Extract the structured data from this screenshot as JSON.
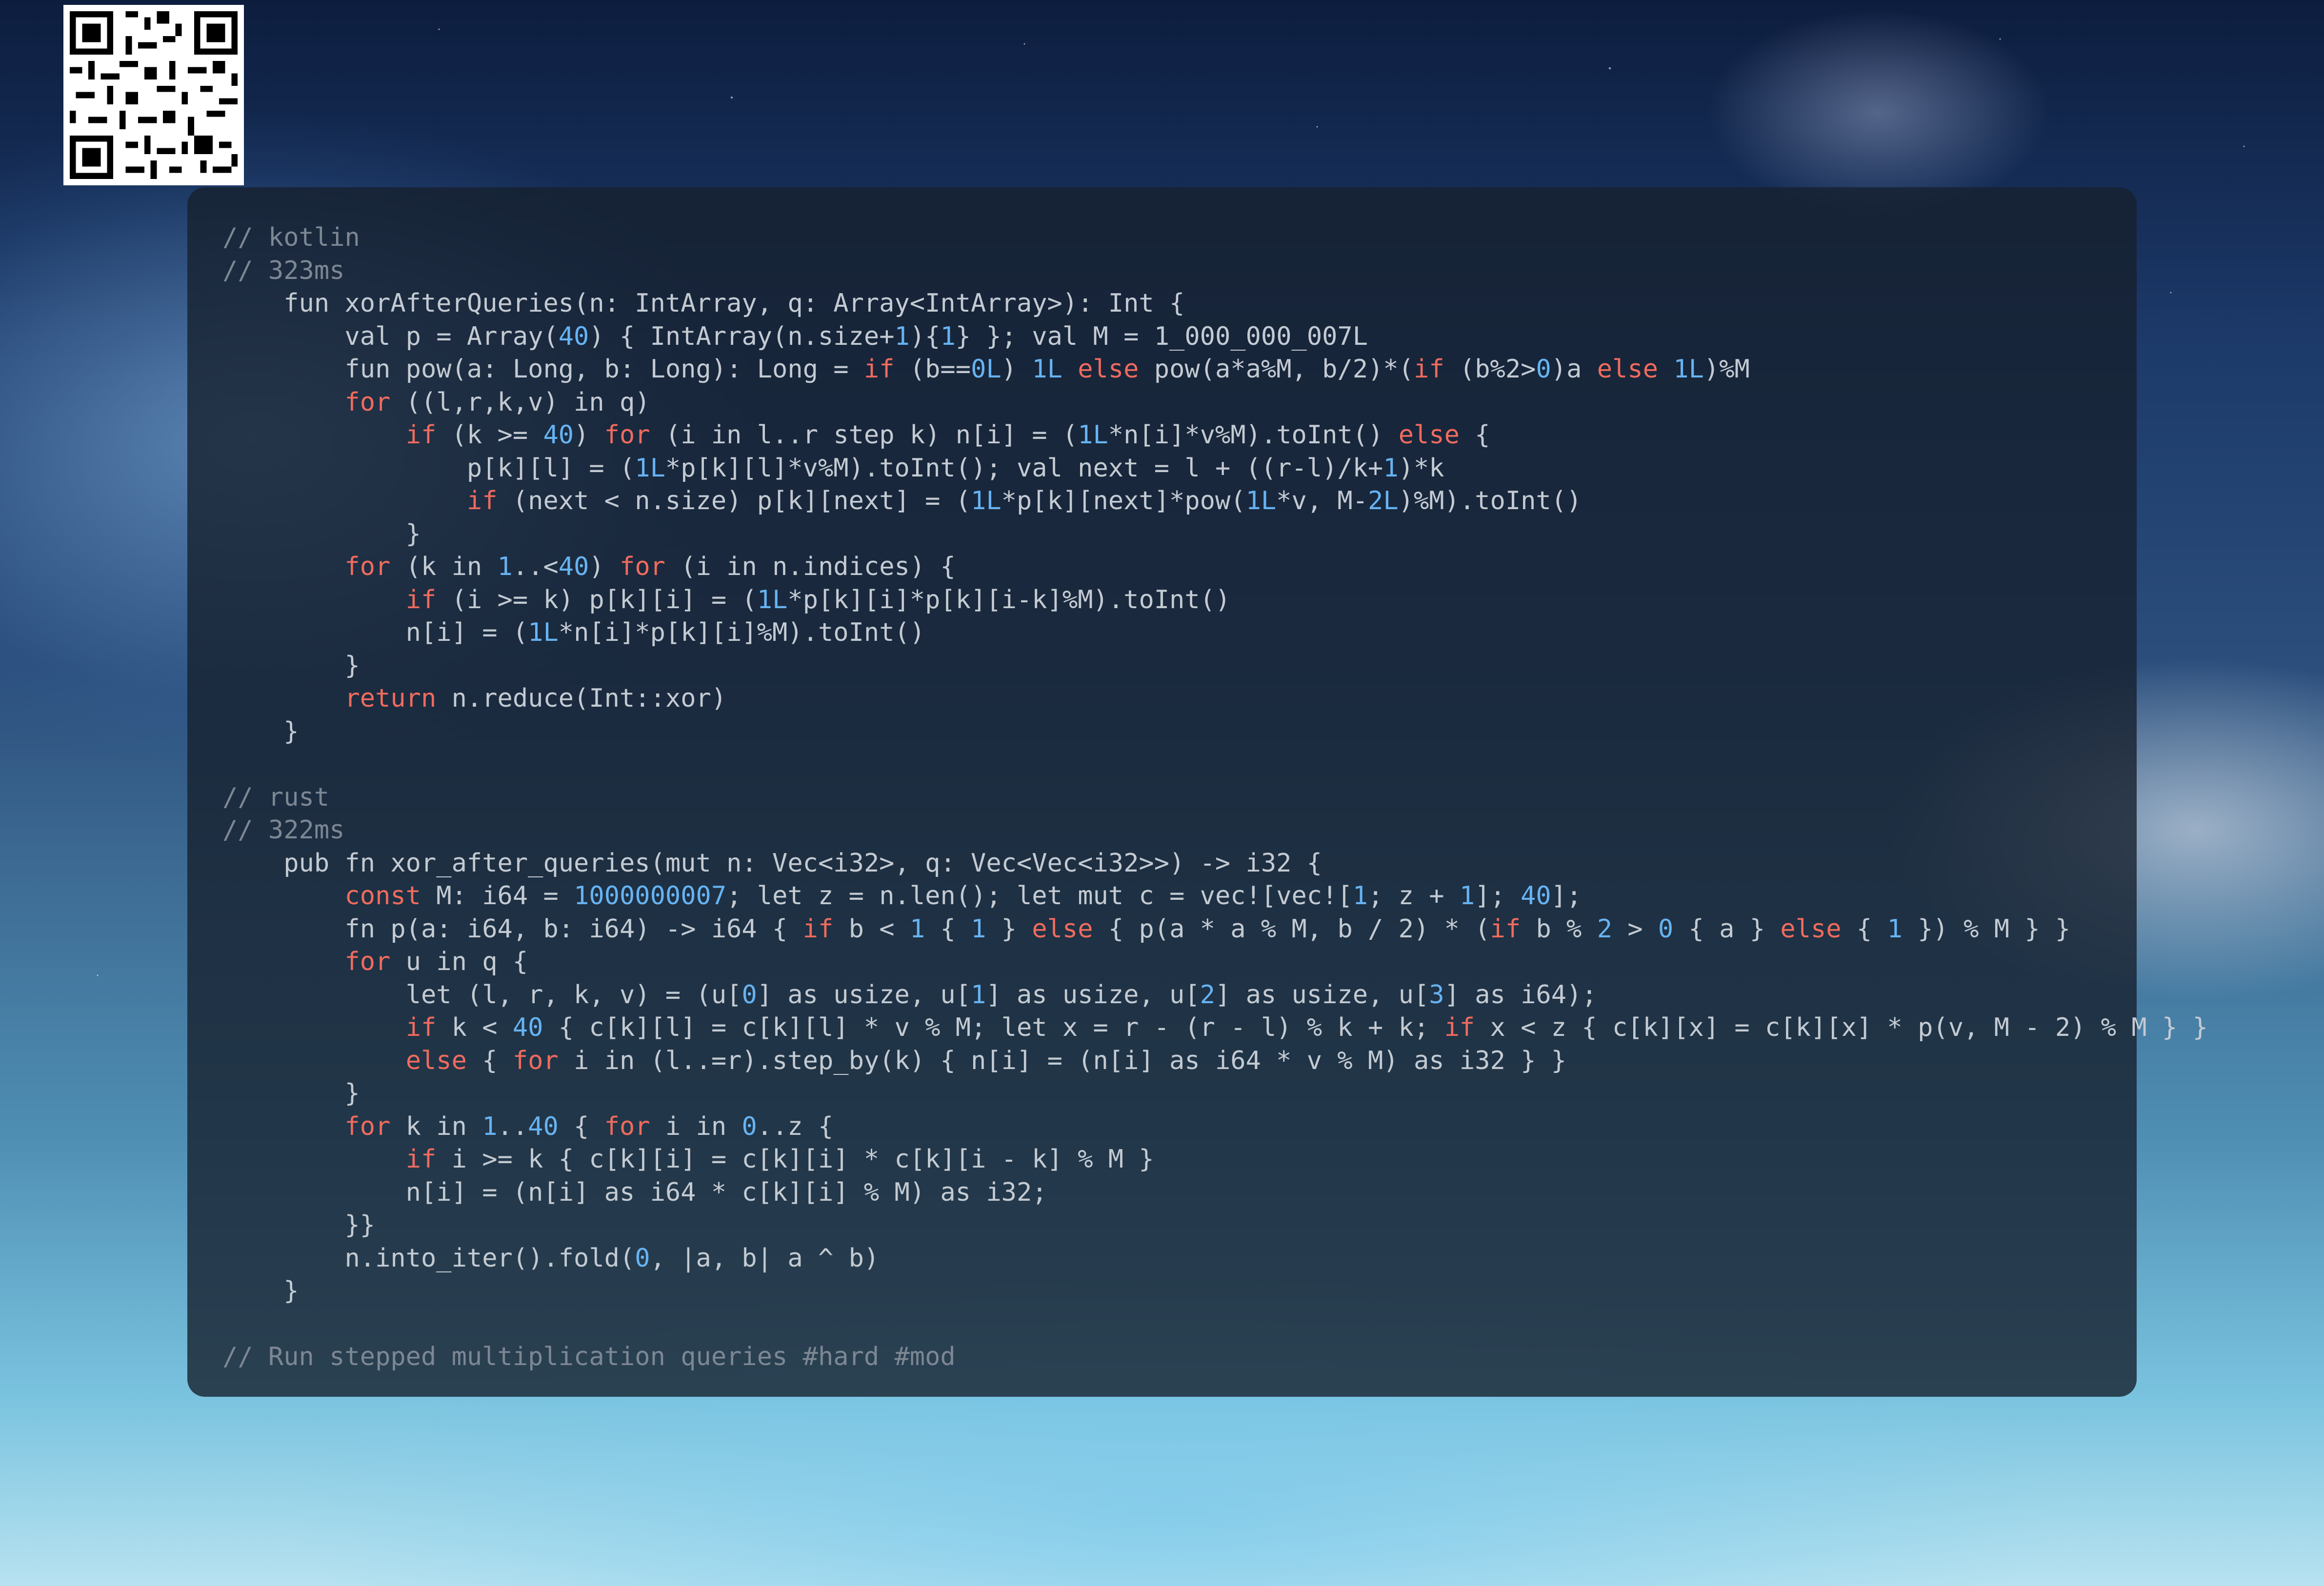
{
  "code": {
    "lines": [
      [
        {
          "t": "// kotlin",
          "c": "c"
        }
      ],
      [
        {
          "t": "// 323ms",
          "c": "c"
        }
      ],
      [
        {
          "t": "    fun xorAfterQueries(n: IntArray, q: Array<IntArray>): Int {"
        }
      ],
      [
        {
          "t": "        val p = Array("
        },
        {
          "t": "40",
          "c": "n"
        },
        {
          "t": ") { IntArray(n.size+"
        },
        {
          "t": "1",
          "c": "n"
        },
        {
          "t": "){"
        },
        {
          "t": "1",
          "c": "n"
        },
        {
          "t": "} }; val M = 1_000_000_007L"
        }
      ],
      [
        {
          "t": "        fun pow(a: Long, b: Long): Long = "
        },
        {
          "t": "if",
          "c": "kw"
        },
        {
          "t": " (b=="
        },
        {
          "t": "0L",
          "c": "n"
        },
        {
          "t": ") "
        },
        {
          "t": "1L",
          "c": "n"
        },
        {
          "t": " "
        },
        {
          "t": "else",
          "c": "kw"
        },
        {
          "t": " pow(a*a%M, b/2)*("
        },
        {
          "t": "if",
          "c": "kw"
        },
        {
          "t": " (b%2>"
        },
        {
          "t": "0",
          "c": "n"
        },
        {
          "t": ")a "
        },
        {
          "t": "else",
          "c": "kw"
        },
        {
          "t": " "
        },
        {
          "t": "1L",
          "c": "n"
        },
        {
          "t": ")%M"
        }
      ],
      [
        {
          "t": "        "
        },
        {
          "t": "for",
          "c": "kw"
        },
        {
          "t": " ((l,r,k,v) in q)"
        }
      ],
      [
        {
          "t": "            "
        },
        {
          "t": "if",
          "c": "kw"
        },
        {
          "t": " (k >= "
        },
        {
          "t": "40",
          "c": "n"
        },
        {
          "t": ") "
        },
        {
          "t": "for",
          "c": "kw"
        },
        {
          "t": " (i in l..r step k) n[i] = ("
        },
        {
          "t": "1L",
          "c": "n"
        },
        {
          "t": "*n[i]*v%M).toInt() "
        },
        {
          "t": "else",
          "c": "kw"
        },
        {
          "t": " {"
        }
      ],
      [
        {
          "t": "                p[k][l] = ("
        },
        {
          "t": "1L",
          "c": "n"
        },
        {
          "t": "*p[k][l]*v%M).toInt(); val next = l + ((r-l)/k+"
        },
        {
          "t": "1",
          "c": "n"
        },
        {
          "t": ")*k"
        }
      ],
      [
        {
          "t": "                "
        },
        {
          "t": "if",
          "c": "kw"
        },
        {
          "t": " (next < n.size) p[k][next] = ("
        },
        {
          "t": "1L",
          "c": "n"
        },
        {
          "t": "*p[k][next]*pow("
        },
        {
          "t": "1L",
          "c": "n"
        },
        {
          "t": "*v, M-"
        },
        {
          "t": "2L",
          "c": "n"
        },
        {
          "t": ")%M).toInt()"
        }
      ],
      [
        {
          "t": "            }"
        }
      ],
      [
        {
          "t": "        "
        },
        {
          "t": "for",
          "c": "kw"
        },
        {
          "t": " (k in "
        },
        {
          "t": "1",
          "c": "n"
        },
        {
          "t": "..<"
        },
        {
          "t": "40",
          "c": "n"
        },
        {
          "t": ") "
        },
        {
          "t": "for",
          "c": "kw"
        },
        {
          "t": " (i in n.indices) {"
        }
      ],
      [
        {
          "t": "            "
        },
        {
          "t": "if",
          "c": "kw"
        },
        {
          "t": " (i >= k) p[k][i] = ("
        },
        {
          "t": "1L",
          "c": "n"
        },
        {
          "t": "*p[k][i]*p[k][i-k]%M).toInt()"
        }
      ],
      [
        {
          "t": "            n[i] = ("
        },
        {
          "t": "1L",
          "c": "n"
        },
        {
          "t": "*n[i]*p[k][i]%M).toInt()"
        }
      ],
      [
        {
          "t": "        }"
        }
      ],
      [
        {
          "t": "        "
        },
        {
          "t": "return",
          "c": "kw"
        },
        {
          "t": " n.reduce(Int::xor)"
        }
      ],
      [
        {
          "t": "    }"
        }
      ],
      [],
      [
        {
          "t": "// rust",
          "c": "c"
        }
      ],
      [
        {
          "t": "// 322ms",
          "c": "c"
        }
      ],
      [
        {
          "t": "    pub fn xor_after_queries(mut n: Vec<i32>, q: Vec<Vec<i32>>) -> i32 {"
        }
      ],
      [
        {
          "t": "        "
        },
        {
          "t": "const",
          "c": "kw"
        },
        {
          "t": " M: i64 = "
        },
        {
          "t": "1000000007",
          "c": "n"
        },
        {
          "t": "; let z = n.len(); let mut c = vec![vec!["
        },
        {
          "t": "1",
          "c": "n"
        },
        {
          "t": "; z + "
        },
        {
          "t": "1",
          "c": "n"
        },
        {
          "t": "]; "
        },
        {
          "t": "40",
          "c": "n"
        },
        {
          "t": "];"
        }
      ],
      [
        {
          "t": "        fn p(a: i64, b: i64) -> i64 { "
        },
        {
          "t": "if",
          "c": "kw"
        },
        {
          "t": " b < "
        },
        {
          "t": "1",
          "c": "n"
        },
        {
          "t": " { "
        },
        {
          "t": "1",
          "c": "n"
        },
        {
          "t": " } "
        },
        {
          "t": "else",
          "c": "kw"
        },
        {
          "t": " { p(a * a % M, b / 2) * ("
        },
        {
          "t": "if",
          "c": "kw"
        },
        {
          "t": " b % "
        },
        {
          "t": "2",
          "c": "n"
        },
        {
          "t": " > "
        },
        {
          "t": "0",
          "c": "n"
        },
        {
          "t": " { a } "
        },
        {
          "t": "else",
          "c": "kw"
        },
        {
          "t": " { "
        },
        {
          "t": "1",
          "c": "n"
        },
        {
          "t": " }) % M } }"
        }
      ],
      [
        {
          "t": "        "
        },
        {
          "t": "for",
          "c": "kw"
        },
        {
          "t": " u in q {"
        }
      ],
      [
        {
          "t": "            let (l, r, k, v) = (u["
        },
        {
          "t": "0",
          "c": "n"
        },
        {
          "t": "] as usize, u["
        },
        {
          "t": "1",
          "c": "n"
        },
        {
          "t": "] as usize, u["
        },
        {
          "t": "2",
          "c": "n"
        },
        {
          "t": "] as usize, u["
        },
        {
          "t": "3",
          "c": "n"
        },
        {
          "t": "] as i64);"
        }
      ],
      [
        {
          "t": "            "
        },
        {
          "t": "if",
          "c": "kw"
        },
        {
          "t": " k < "
        },
        {
          "t": "40",
          "c": "n"
        },
        {
          "t": " { c[k][l] = c[k][l] * v % M; let x = r - (r - l) % k + k; "
        },
        {
          "t": "if",
          "c": "kw"
        },
        {
          "t": " x < z { c[k][x] = c[k][x] * p(v, M - 2) % M } }"
        }
      ],
      [
        {
          "t": "            "
        },
        {
          "t": "else",
          "c": "kw"
        },
        {
          "t": " { "
        },
        {
          "t": "for",
          "c": "kw"
        },
        {
          "t": " i in (l..=r).step_by(k) { n[i] = (n[i] as i64 * v % M) as i32 } }"
        }
      ],
      [
        {
          "t": "        }"
        }
      ],
      [
        {
          "t": "        "
        },
        {
          "t": "for",
          "c": "kw"
        },
        {
          "t": " k in "
        },
        {
          "t": "1",
          "c": "n"
        },
        {
          "t": ".."
        },
        {
          "t": "40",
          "c": "n"
        },
        {
          "t": " { "
        },
        {
          "t": "for",
          "c": "kw"
        },
        {
          "t": " i in "
        },
        {
          "t": "0",
          "c": "n"
        },
        {
          "t": "..z {"
        }
      ],
      [
        {
          "t": "            "
        },
        {
          "t": "if",
          "c": "kw"
        },
        {
          "t": " i >= k { c[k][i] = c[k][i] * c[k][i - k] % M }"
        }
      ],
      [
        {
          "t": "            n[i] = (n[i] as i64 * c[k][i] % M) as i32;"
        }
      ],
      [
        {
          "t": "        }}"
        }
      ],
      [
        {
          "t": "        n.into_iter().fold("
        },
        {
          "t": "0",
          "c": "n"
        },
        {
          "t": ", |a, b| a ^ b)"
        }
      ],
      [
        {
          "t": "    }"
        }
      ],
      [],
      [
        {
          "t": "// Run stepped multiplication queries #hard #mod",
          "c": "c"
        }
      ]
    ]
  }
}
